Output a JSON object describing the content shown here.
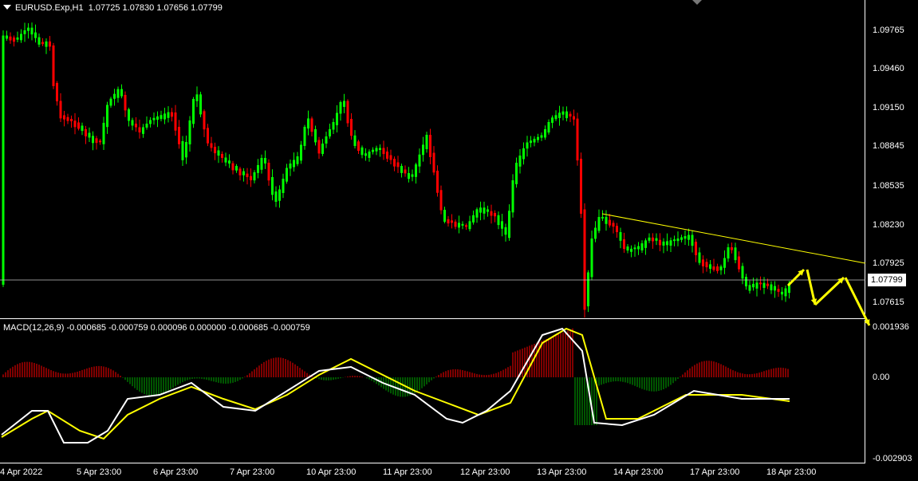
{
  "main": {
    "symbol": "EURUSD.Exp,H1",
    "ohlc": "1.07725 1.07830 1.07656 1.07799",
    "price_axis": [
      "1.09765",
      "1.09460",
      "1.09150",
      "1.08845",
      "1.08535",
      "1.08230",
      "1.07925",
      "1.07615"
    ],
    "current_price": "1.07799",
    "colors": {
      "bull": "#00ff00",
      "bear": "#ff0000",
      "trendline": "#ffff00",
      "arrows": "#ffff00",
      "grid_line": "#c0c0c0"
    }
  },
  "macd": {
    "title": "MACD(12,26,9) -0.000685 -0.000759 0.000096 0.000000 -0.000685 -0.000759",
    "axis": [
      "0.001936",
      "0.00",
      "-0.002903"
    ],
    "colors": {
      "main": "#ffffff",
      "signal": "#ffff00",
      "hist_pos": "#ff0000",
      "hist_neg": "#00aa00"
    }
  },
  "time_axis": [
    "4 Apr 2022",
    "5 Apr 23:00",
    "6 Apr 23:00",
    "7 Apr 23:00",
    "10 Apr 23:00",
    "11 Apr 23:00",
    "12 Apr 23:00",
    "13 Apr 23:00",
    "14 Apr 23:00",
    "17 Apr 23:00",
    "18 Apr 23:00"
  ]
}
